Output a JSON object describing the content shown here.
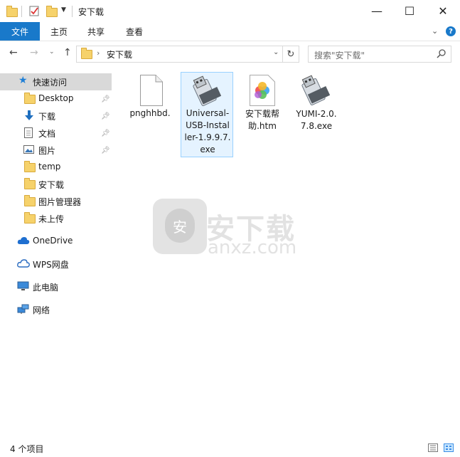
{
  "window": {
    "title": "安下载",
    "minimize_glyph": "—",
    "maximize_glyph": "☐",
    "close_glyph": "✕"
  },
  "ribbon": {
    "tabs": [
      {
        "label": "文件"
      },
      {
        "label": "主页"
      },
      {
        "label": "共享"
      },
      {
        "label": "查看"
      }
    ]
  },
  "address": {
    "path": "安下载",
    "search_placeholder": "搜索\"安下载\""
  },
  "sidebar": {
    "quick_access": "快速访问",
    "items": [
      {
        "label": "Desktop",
        "icon": "folder-icon",
        "pinned": true
      },
      {
        "label": "下载",
        "icon": "download-arrow-icon",
        "pinned": true
      },
      {
        "label": "文档",
        "icon": "document-icon",
        "pinned": true
      },
      {
        "label": "图片",
        "icon": "picture-icon",
        "pinned": true
      },
      {
        "label": "temp",
        "icon": "folder-icon",
        "pinned": false
      },
      {
        "label": "安下载",
        "icon": "folder-icon",
        "pinned": false
      },
      {
        "label": "图片管理器",
        "icon": "folder-icon",
        "pinned": false
      },
      {
        "label": "未上传",
        "icon": "folder-icon",
        "pinned": false
      }
    ],
    "onedrive": "OneDrive",
    "wps": "WPS网盘",
    "this_pc": "此电脑",
    "network": "网络"
  },
  "files": [
    {
      "name_lines": [
        "pnghhbd."
      ],
      "icon": "blank-file-icon"
    },
    {
      "name_lines": [
        "Universal-",
        "USB-Instal",
        "ler-1.9.9.7.",
        "exe"
      ],
      "icon": "usb-drive-icon",
      "selected": true
    },
    {
      "name_lines": [
        "安下载帮",
        "助.htm"
      ],
      "icon": "colorful-htm-icon"
    },
    {
      "name_lines": [
        "YUMI-2.0.",
        "7.8.exe"
      ],
      "icon": "usb-drive-icon"
    }
  ],
  "watermark": {
    "cn": "安下载",
    "en": "anxz.com",
    "badge": "安"
  },
  "status": {
    "item_count": "4 个项目"
  },
  "colors": {
    "accent": "#1979ca",
    "folder": "#f6d26b",
    "selection": "#cce8ff"
  }
}
